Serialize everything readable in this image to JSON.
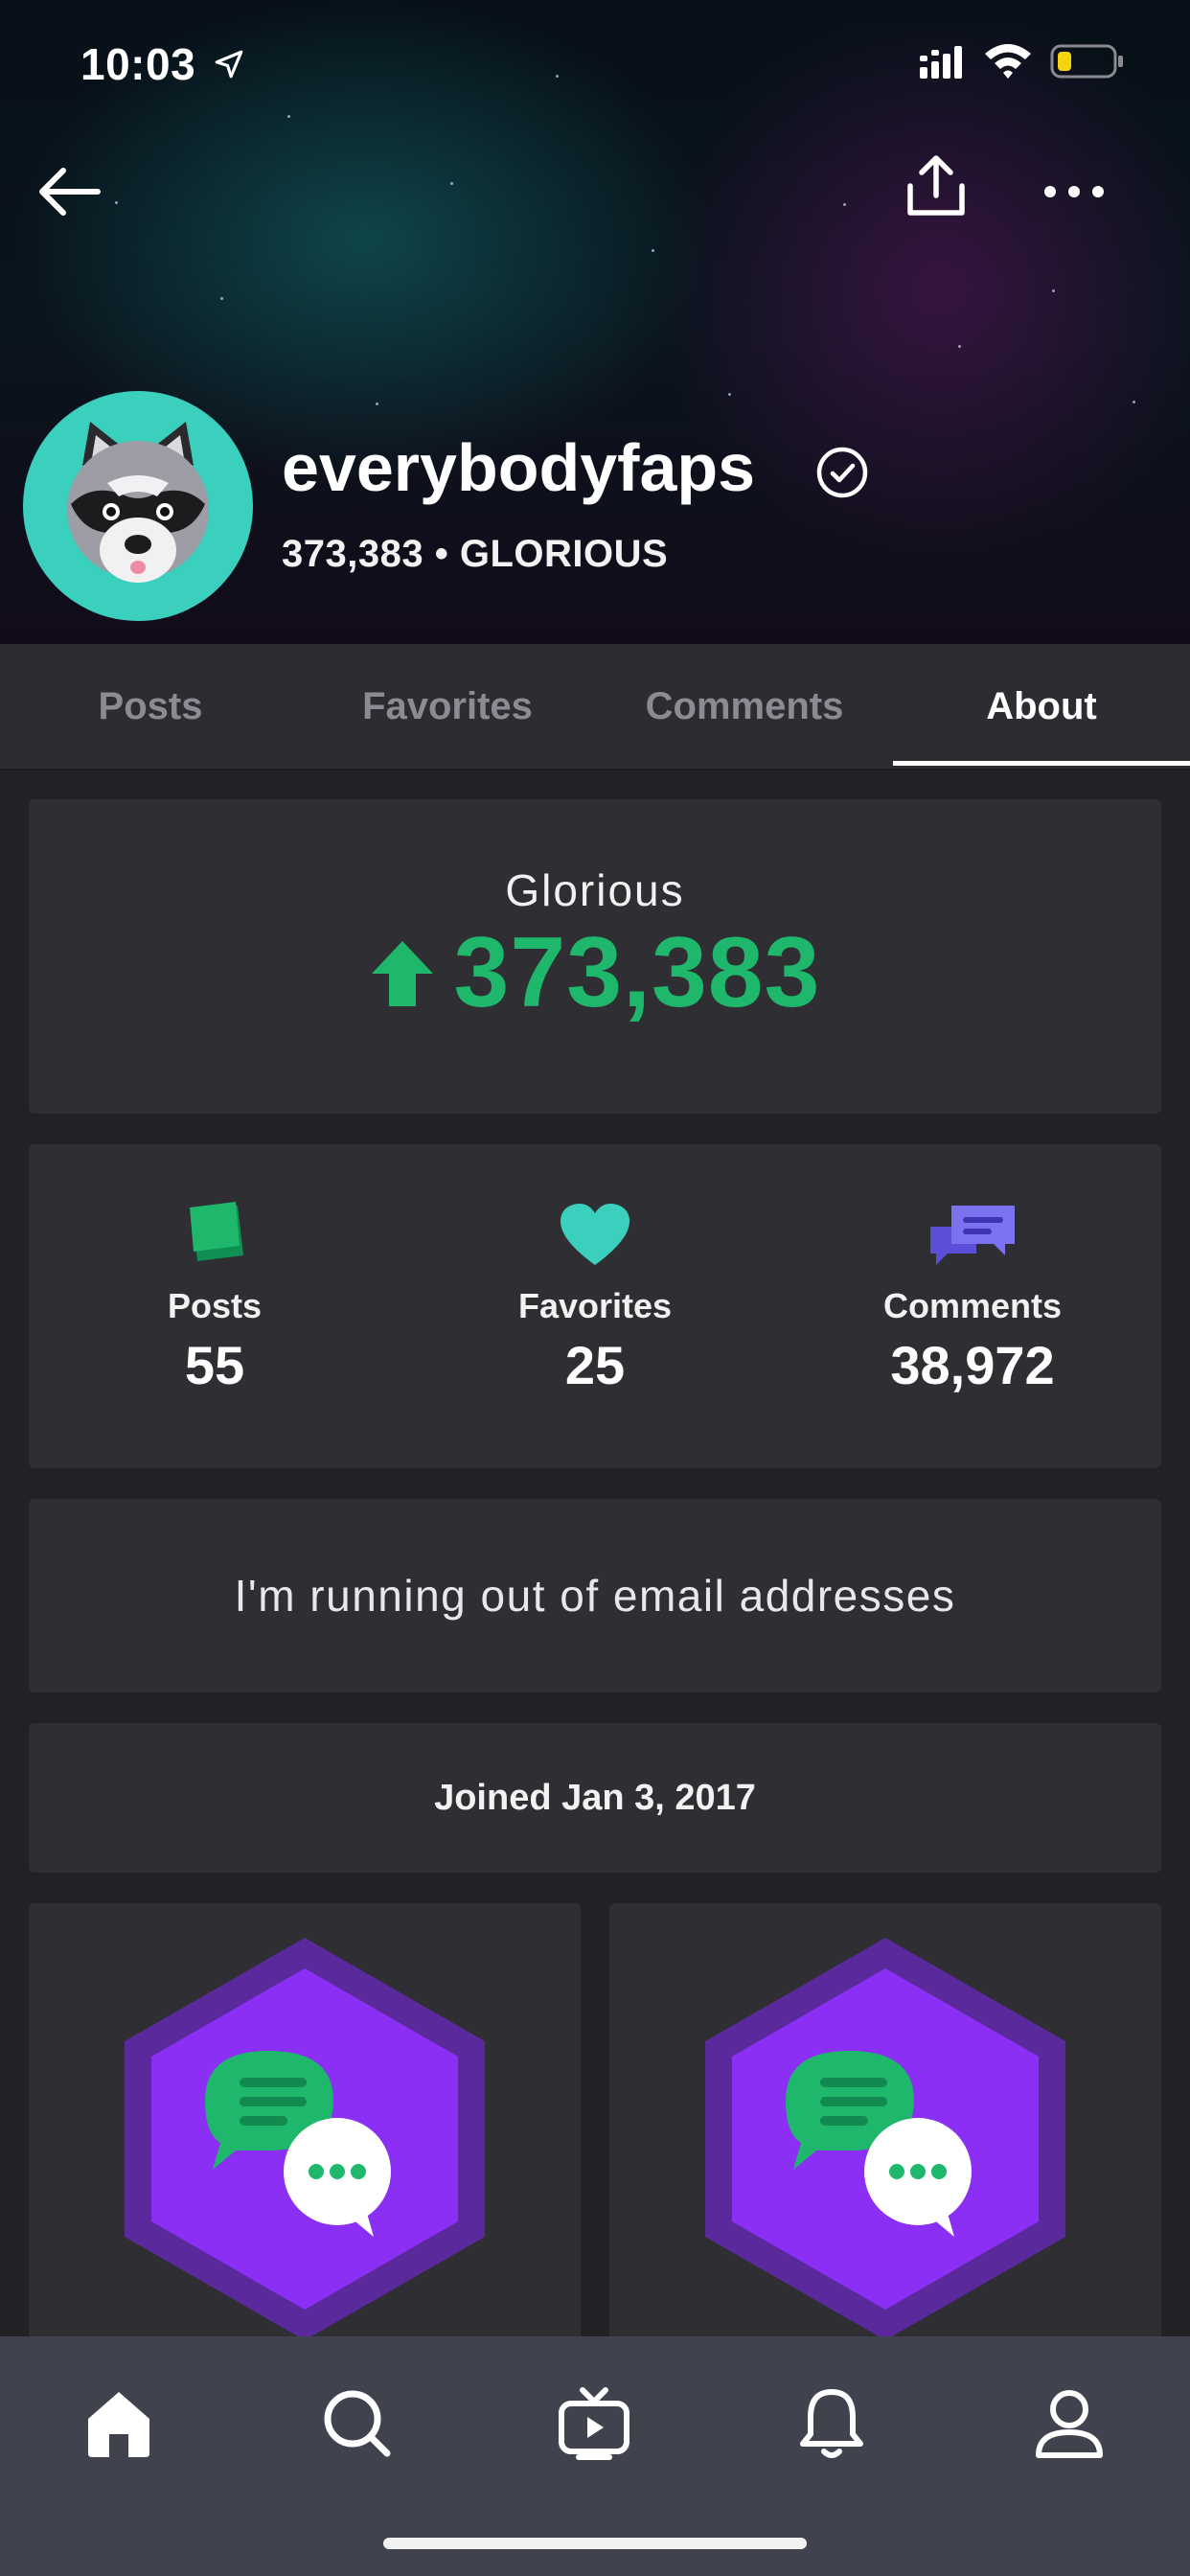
{
  "status_bar": {
    "time": "10:03"
  },
  "profile": {
    "username": "everybodyfaps",
    "score": "373,383",
    "rank": "GLORIOUS",
    "separator": "•"
  },
  "tabs": [
    {
      "label": "Posts"
    },
    {
      "label": "Favorites"
    },
    {
      "label": "Comments"
    },
    {
      "label": "About",
      "active": true
    }
  ],
  "about": {
    "score_card": {
      "title": "Glorious",
      "value": "373,383"
    },
    "stats": [
      {
        "label": "Posts",
        "value": "55",
        "icon": "posts-icon"
      },
      {
        "label": "Favorites",
        "value": "25",
        "icon": "heart-icon"
      },
      {
        "label": "Comments",
        "value": "38,972",
        "icon": "comments-icon"
      }
    ],
    "bio": "I'm running out of email addresses",
    "joined": "Joined Jan 3, 2017"
  },
  "trophies": [
    {
      "icon": "comment-trophy-icon"
    },
    {
      "icon": "comment-trophy-icon"
    }
  ],
  "bottom_nav": [
    {
      "icon": "home-icon",
      "active": true
    },
    {
      "icon": "search-icon"
    },
    {
      "icon": "tv-icon"
    },
    {
      "icon": "bell-icon"
    },
    {
      "icon": "profile-icon"
    }
  ],
  "colors": {
    "accent_green": "#1eb76c",
    "teal": "#3bcfbd",
    "purple": "#8b2ff5",
    "background": "#222226",
    "card": "#2e2e33"
  }
}
